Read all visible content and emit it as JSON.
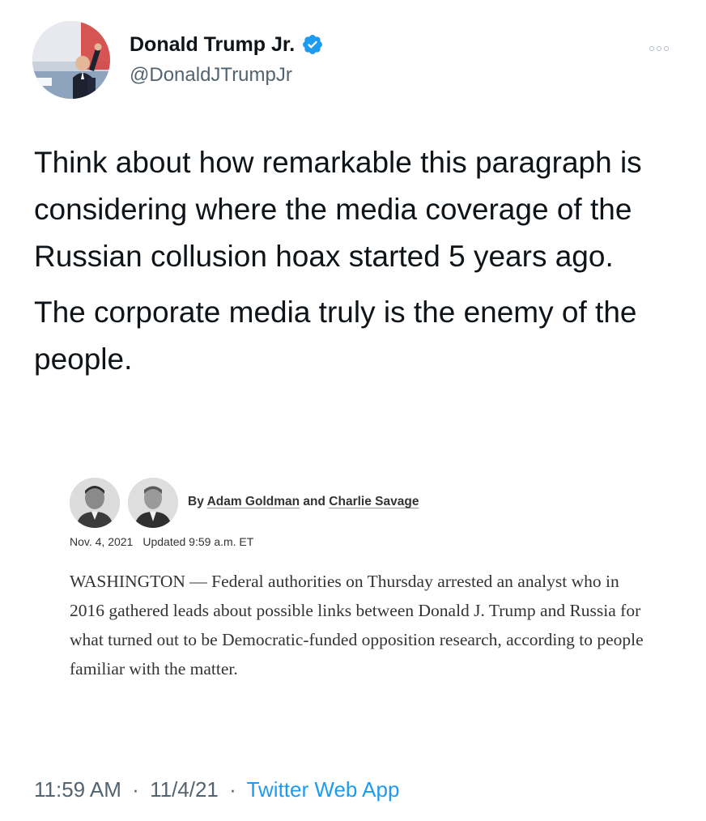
{
  "tweet": {
    "author": {
      "display_name": "Donald Trump Jr.",
      "handle": "@DonaldJTrumpJr",
      "verified": true,
      "avatar_icon": "profile-photo",
      "verified_icon": "verified-badge-icon",
      "verified_color": "#1d9bf0"
    },
    "more_icon": "more-options-icon",
    "paragraphs": [
      "Think about how remarkable this paragraph is considering where the media coverage of the Russian collusion hoax started 5 years ago.",
      "The corporate media truly is the enemy of the people."
    ],
    "media": {
      "byline_prefix": "By",
      "author_1": "Adam Goldman",
      "byline_joiner": "and",
      "author_2": "Charlie Savage",
      "date": "Nov. 4, 2021",
      "updated": "Updated 9:59 a.m. ET",
      "body": "WASHINGTON — Federal authorities on Thursday arrested an analyst who in 2016 gathered leads about possible links between Donald J. Trump and Russia for what turned out to be Democratic-funded opposition research, according to people familiar with the matter."
    },
    "footer": {
      "time": "11:59 AM",
      "separator": "·",
      "date": "11/4/21",
      "source": "Twitter Web App"
    }
  },
  "colors": {
    "text_primary": "#0f1419",
    "text_secondary": "#536471",
    "link": "#1d9bf0"
  }
}
